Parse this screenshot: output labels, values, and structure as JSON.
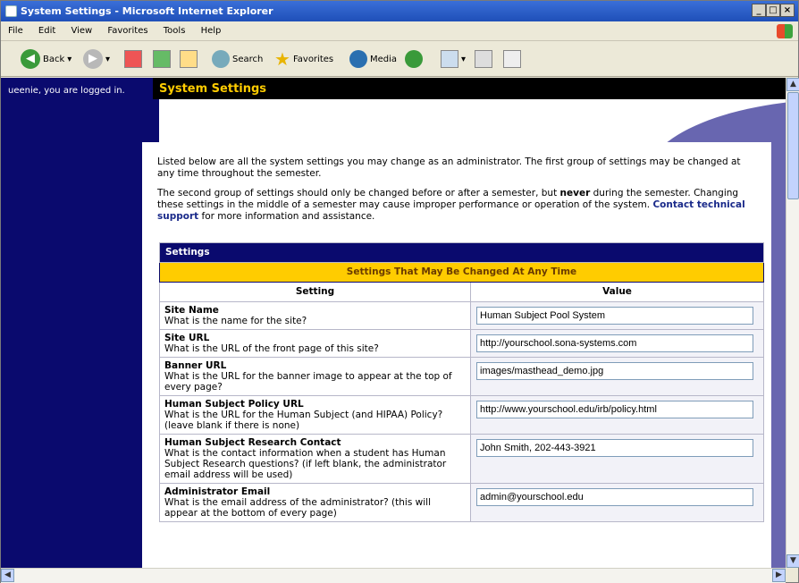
{
  "window": {
    "title": "System Settings - Microsoft Internet Explorer"
  },
  "menu": [
    "File",
    "Edit",
    "View",
    "Favorites",
    "Tools",
    "Help"
  ],
  "toolbar": {
    "back": "Back",
    "search": "Search",
    "favorites": "Favorites",
    "media": "Media"
  },
  "page": {
    "logged_in": "ueenie, you are logged in.",
    "title": "System Settings",
    "intro1": "Listed below are all the system settings you may change as an administrator. The first group of settings may be changed at any time throughout the semester.",
    "intro2_a": "The second group of settings should only be changed before or after a semester, but ",
    "intro2_never": "never",
    "intro2_b": " during the semester. Changing these settings in the middle of a semester may cause improper performance or operation of the system. ",
    "intro2_link": "Contact technical support",
    "intro2_c": " for more information and assistance."
  },
  "settings": {
    "header": "Settings",
    "group": "Settings That May Be Changed At Any Time",
    "col_setting": "Setting",
    "col_value": "Value",
    "rows": [
      {
        "name": "Site Name",
        "desc": "What is the name for the site?",
        "value": "Human Subject Pool System"
      },
      {
        "name": "Site URL",
        "desc": "What is the URL of the front page of this site?",
        "value": "http://yourschool.sona-systems.com"
      },
      {
        "name": "Banner URL",
        "desc": "What is the URL for the banner image to appear at the top of every page?",
        "value": "images/masthead_demo.jpg"
      },
      {
        "name": "Human Subject Policy URL",
        "desc": "What is the URL for the Human Subject (and HIPAA) Policy? (leave blank if there is none)",
        "value": "http://www.yourschool.edu/irb/policy.html"
      },
      {
        "name": "Human Subject Research Contact",
        "desc": "What is the contact information when a student has Human Subject Research questions? (if left blank, the administrator email address will be used)",
        "value": "John Smith, 202-443-3921"
      },
      {
        "name": "Administrator Email",
        "desc": "What is the email address of the administrator? (this will appear at the bottom of every page)",
        "value": "admin@yourschool.edu"
      }
    ]
  }
}
